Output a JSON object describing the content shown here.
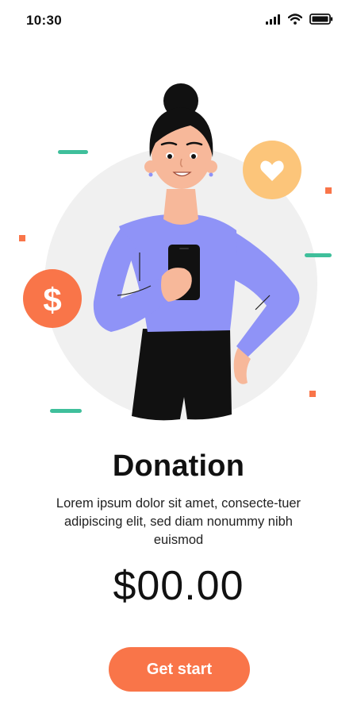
{
  "status_bar": {
    "time": "10:30"
  },
  "content": {
    "title": "Donation",
    "description": "Lorem ipsum dolor sit amet, consecte-tuer adipiscing elit, sed diam nonummy nibh euismod",
    "amount": "$00.00",
    "cta_label": "Get start"
  },
  "illustration": {
    "coin_symbol": "$",
    "icons": [
      "dollar-coin-icon",
      "heart-icon",
      "phone-icon"
    ]
  },
  "colors": {
    "accent": "#f97549",
    "heart_bubble": "#fcc57a",
    "shirt": "#8f93f7",
    "background_circle": "#f0f0f0",
    "dash_green": "#3fbf9b"
  }
}
